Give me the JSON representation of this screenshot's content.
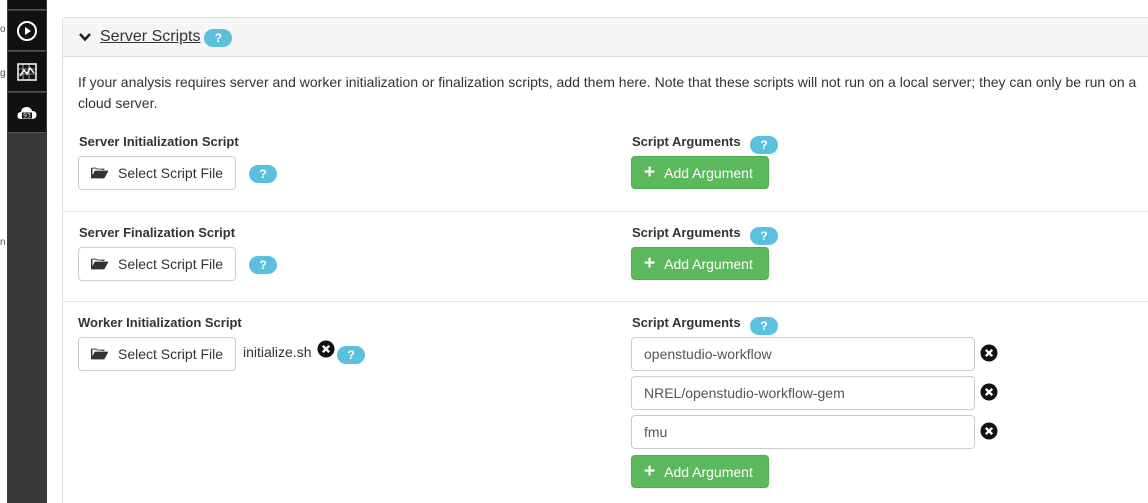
{
  "left_edge": {
    "fragments": [
      "o",
      "g",
      "n"
    ]
  },
  "sidebar": {
    "items": [
      {
        "icon": "play-circle-icon"
      },
      {
        "icon": "chart-map-icon"
      },
      {
        "icon": "cloud-upload-icon"
      }
    ]
  },
  "panel": {
    "title": "Server Scripts",
    "help": "?",
    "intro": "If your analysis requires server and worker initialization or finalization scripts, add them here. Note that these scripts will not run on a local server; they can only be run on a cloud server."
  },
  "sections": {
    "server_init": {
      "label": "Server Initialization Script",
      "select_label": "Select Script File",
      "args_label": "Script Arguments",
      "add_label": "Add Argument"
    },
    "server_final": {
      "label": "Server Finalization Script",
      "select_label": "Select Script File",
      "args_label": "Script Arguments",
      "add_label": "Add Argument"
    },
    "worker_init": {
      "label": "Worker Initialization Script",
      "select_label": "Select Script File",
      "file_name": "initialize.sh",
      "args_label": "Script Arguments",
      "args": [
        "openstudio-workflow",
        "NREL/openstudio-workflow-gem",
        "fmu"
      ],
      "add_label": "Add Argument"
    }
  },
  "colors": {
    "help_badge": "#5bc0de",
    "success": "#5cb85c",
    "sidebar": "#3a3a3a"
  }
}
